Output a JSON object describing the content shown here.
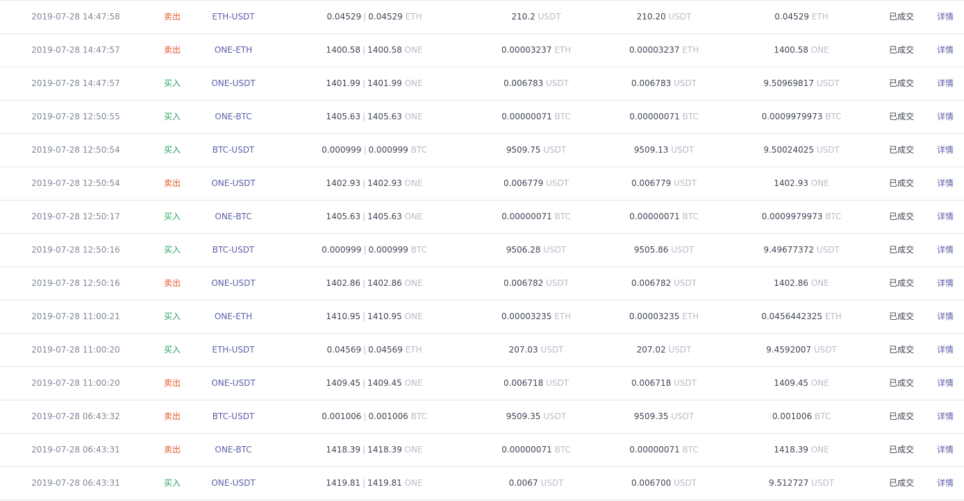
{
  "rows": [
    {
      "time": "2019-07-28 14:47:58",
      "side": "卖出",
      "side_type": "sell",
      "pair": "ETH-USDT",
      "amount_filled": "0.04529",
      "amount_total": "0.04529",
      "amount_unit": "ETH",
      "price": "210.2",
      "price_unit": "USDT",
      "avg_price": "210.20",
      "avg_unit": "USDT",
      "total": "0.04529",
      "total_unit": "ETH",
      "status": "已成交",
      "detail": "详情"
    },
    {
      "time": "2019-07-28 14:47:57",
      "side": "卖出",
      "side_type": "sell",
      "pair": "ONE-ETH",
      "amount_filled": "1400.58",
      "amount_total": "1400.58",
      "amount_unit": "ONE",
      "price": "0.00003237",
      "price_unit": "ETH",
      "avg_price": "0.00003237",
      "avg_unit": "ETH",
      "total": "1400.58",
      "total_unit": "ONE",
      "status": "已成交",
      "detail": "详情"
    },
    {
      "time": "2019-07-28 14:47:57",
      "side": "买入",
      "side_type": "buy",
      "pair": "ONE-USDT",
      "amount_filled": "1401.99",
      "amount_total": "1401.99",
      "amount_unit": "ONE",
      "price": "0.006783",
      "price_unit": "USDT",
      "avg_price": "0.006783",
      "avg_unit": "USDT",
      "total": "9.50969817",
      "total_unit": "USDT",
      "status": "已成交",
      "detail": "详情"
    },
    {
      "time": "2019-07-28 12:50:55",
      "side": "买入",
      "side_type": "buy",
      "pair": "ONE-BTC",
      "amount_filled": "1405.63",
      "amount_total": "1405.63",
      "amount_unit": "ONE",
      "price": "0.00000071",
      "price_unit": "BTC",
      "avg_price": "0.00000071",
      "avg_unit": "BTC",
      "total": "0.0009979973",
      "total_unit": "BTC",
      "status": "已成交",
      "detail": "详情"
    },
    {
      "time": "2019-07-28 12:50:54",
      "side": "买入",
      "side_type": "buy",
      "pair": "BTC-USDT",
      "amount_filled": "0.000999",
      "amount_total": "0.000999",
      "amount_unit": "BTC",
      "price": "9509.75",
      "price_unit": "USDT",
      "avg_price": "9509.13",
      "avg_unit": "USDT",
      "total": "9.50024025",
      "total_unit": "USDT",
      "status": "已成交",
      "detail": "详情"
    },
    {
      "time": "2019-07-28 12:50:54",
      "side": "卖出",
      "side_type": "sell",
      "pair": "ONE-USDT",
      "amount_filled": "1402.93",
      "amount_total": "1402.93",
      "amount_unit": "ONE",
      "price": "0.006779",
      "price_unit": "USDT",
      "avg_price": "0.006779",
      "avg_unit": "USDT",
      "total": "1402.93",
      "total_unit": "ONE",
      "status": "已成交",
      "detail": "详情"
    },
    {
      "time": "2019-07-28 12:50:17",
      "side": "买入",
      "side_type": "buy",
      "pair": "ONE-BTC",
      "amount_filled": "1405.63",
      "amount_total": "1405.63",
      "amount_unit": "ONE",
      "price": "0.00000071",
      "price_unit": "BTC",
      "avg_price": "0.00000071",
      "avg_unit": "BTC",
      "total": "0.0009979973",
      "total_unit": "BTC",
      "status": "已成交",
      "detail": "详情"
    },
    {
      "time": "2019-07-28 12:50:16",
      "side": "买入",
      "side_type": "buy",
      "pair": "BTC-USDT",
      "amount_filled": "0.000999",
      "amount_total": "0.000999",
      "amount_unit": "BTC",
      "price": "9506.28",
      "price_unit": "USDT",
      "avg_price": "9505.86",
      "avg_unit": "USDT",
      "total": "9.49677372",
      "total_unit": "USDT",
      "status": "已成交",
      "detail": "详情"
    },
    {
      "time": "2019-07-28 12:50:16",
      "side": "卖出",
      "side_type": "sell",
      "pair": "ONE-USDT",
      "amount_filled": "1402.86",
      "amount_total": "1402.86",
      "amount_unit": "ONE",
      "price": "0.006782",
      "price_unit": "USDT",
      "avg_price": "0.006782",
      "avg_unit": "USDT",
      "total": "1402.86",
      "total_unit": "ONE",
      "status": "已成交",
      "detail": "详情"
    },
    {
      "time": "2019-07-28 11:00:21",
      "side": "买入",
      "side_type": "buy",
      "pair": "ONE-ETH",
      "amount_filled": "1410.95",
      "amount_total": "1410.95",
      "amount_unit": "ONE",
      "price": "0.00003235",
      "price_unit": "ETH",
      "avg_price": "0.00003235",
      "avg_unit": "ETH",
      "total": "0.0456442325",
      "total_unit": "ETH",
      "status": "已成交",
      "detail": "详情"
    },
    {
      "time": "2019-07-28 11:00:20",
      "side": "买入",
      "side_type": "buy",
      "pair": "ETH-USDT",
      "amount_filled": "0.04569",
      "amount_total": "0.04569",
      "amount_unit": "ETH",
      "price": "207.03",
      "price_unit": "USDT",
      "avg_price": "207.02",
      "avg_unit": "USDT",
      "total": "9.4592007",
      "total_unit": "USDT",
      "status": "已成交",
      "detail": "详情"
    },
    {
      "time": "2019-07-28 11:00:20",
      "side": "卖出",
      "side_type": "sell",
      "pair": "ONE-USDT",
      "amount_filled": "1409.45",
      "amount_total": "1409.45",
      "amount_unit": "ONE",
      "price": "0.006718",
      "price_unit": "USDT",
      "avg_price": "0.006718",
      "avg_unit": "USDT",
      "total": "1409.45",
      "total_unit": "ONE",
      "status": "已成交",
      "detail": "详情"
    },
    {
      "time": "2019-07-28 06:43:32",
      "side": "卖出",
      "side_type": "sell",
      "pair": "BTC-USDT",
      "amount_filled": "0.001006",
      "amount_total": "0.001006",
      "amount_unit": "BTC",
      "price": "9509.35",
      "price_unit": "USDT",
      "avg_price": "9509.35",
      "avg_unit": "USDT",
      "total": "0.001006",
      "total_unit": "BTC",
      "status": "已成交",
      "detail": "详情"
    },
    {
      "time": "2019-07-28 06:43:31",
      "side": "卖出",
      "side_type": "sell",
      "pair": "ONE-BTC",
      "amount_filled": "1418.39",
      "amount_total": "1418.39",
      "amount_unit": "ONE",
      "price": "0.00000071",
      "price_unit": "BTC",
      "avg_price": "0.00000071",
      "avg_unit": "BTC",
      "total": "1418.39",
      "total_unit": "ONE",
      "status": "已成交",
      "detail": "详情"
    },
    {
      "time": "2019-07-28 06:43:31",
      "side": "买入",
      "side_type": "buy",
      "pair": "ONE-USDT",
      "amount_filled": "1419.81",
      "amount_total": "1419.81",
      "amount_unit": "ONE",
      "price": "0.0067",
      "price_unit": "USDT",
      "avg_price": "0.006700",
      "avg_unit": "USDT",
      "total": "9.512727",
      "total_unit": "USDT",
      "status": "已成交",
      "detail": "详情"
    }
  ],
  "colors": {
    "buy": "#27a35a",
    "sell": "#e4572e",
    "unit": "#b7bcc8",
    "link": "#5a5ea8"
  }
}
